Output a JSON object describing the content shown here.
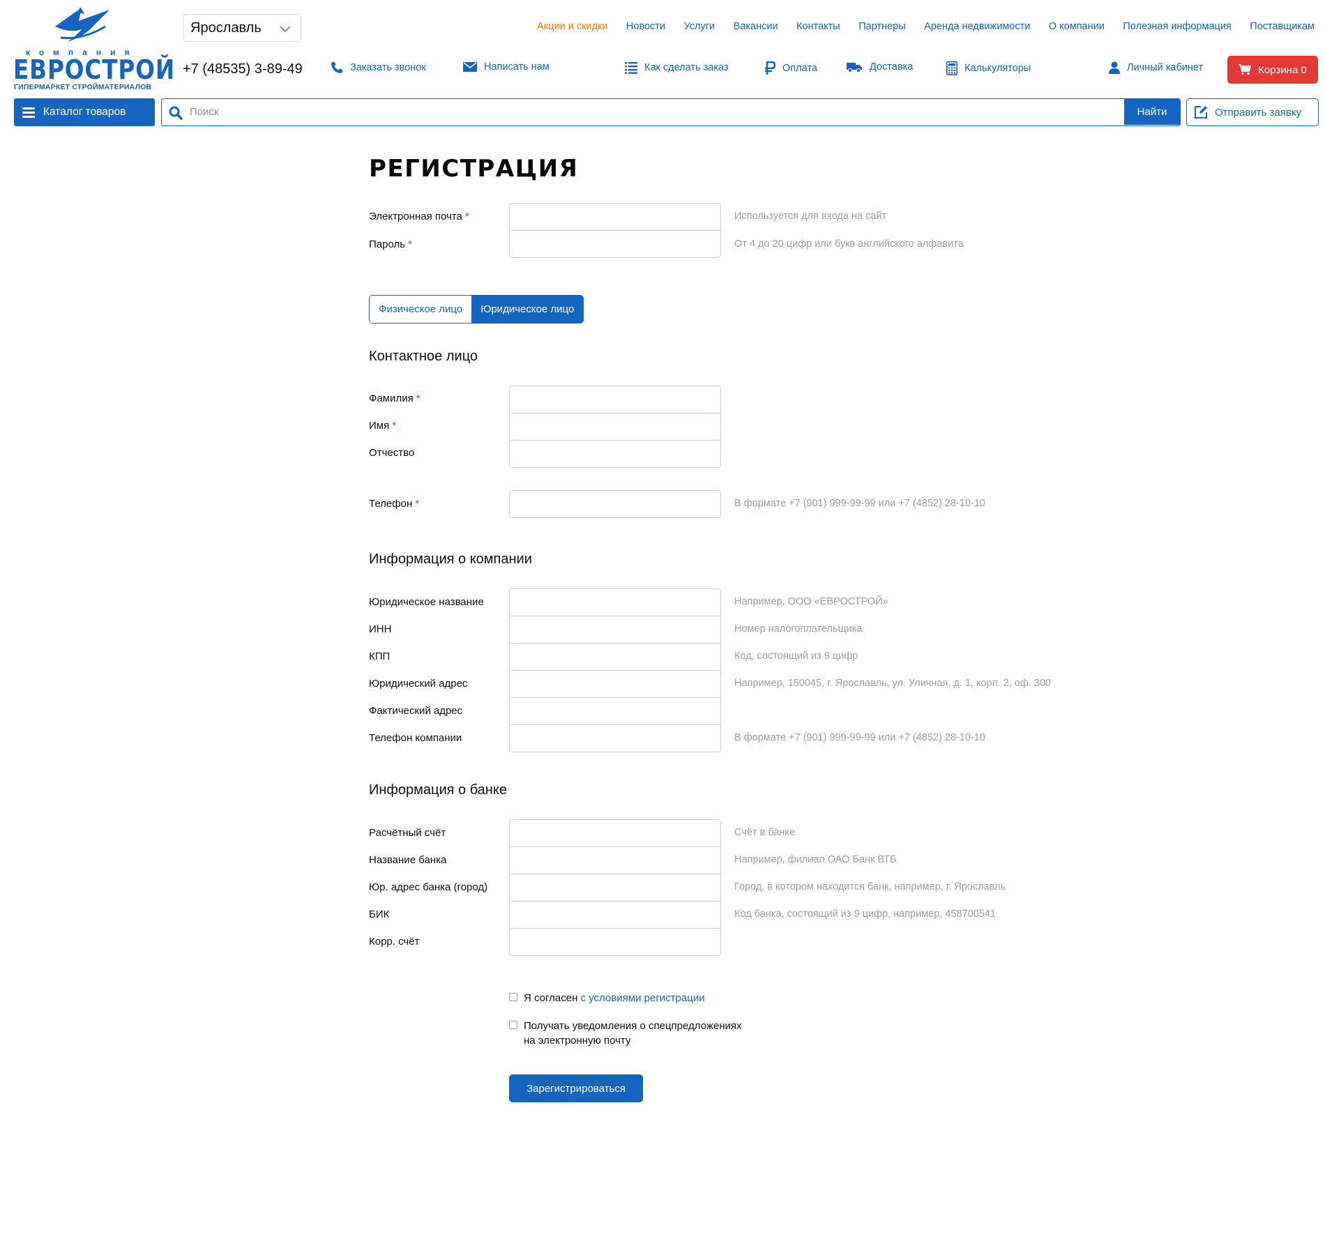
{
  "brand": {
    "company_word": "компания",
    "name": "ЕВРОСТРОЙ",
    "tagline": "ГИПЕРМАРКЕТ СТРОЙМАТЕРИАЛОВ",
    "primary_color": "#1565c0",
    "accent_color": "#e53935",
    "promo_color": "#f57c00"
  },
  "header": {
    "city": "Ярославль",
    "phone": "+7 (48535) 3-89-49",
    "call_link": "Заказать звонок",
    "write_link": "Написать нам",
    "top_nav": [
      "Акции и скидки",
      "Новости",
      "Услуги",
      "Вакансии",
      "Контакты",
      "Партнеры",
      "Аренда недвижимости",
      "О компании",
      "Полезная информация",
      "Поставщикам"
    ],
    "how_to_order": "Как сделать заказ",
    "payment": "Оплата",
    "delivery": "Доставка",
    "calculators": "Калькуляторы",
    "account": "Личный кабинет",
    "cart_label": "Корзина 0",
    "catalog_label": "Каталог товаров",
    "search_placeholder": "Поиск",
    "search_button": "Найти",
    "send_request": "Отправить заявку"
  },
  "form": {
    "title": "РЕГИСТРАЦИЯ",
    "required_mark": "*",
    "email_label": "Электронная почта",
    "email_hint": "Используется для входа на сайт",
    "password_label": "Пароль",
    "password_hint": "От 4 до 20 цифр или букв английского алфавита",
    "toggle_person": "Физическое лицо",
    "toggle_company": "Юридическое лицо",
    "active_toggle": "Юридическое лицо",
    "contact_section": "Контактное лицо",
    "lastname_label": "Фамилия",
    "firstname_label": "Имя",
    "middlename_label": "Отчество",
    "phone_label": "Телефон",
    "phone_hint": "В формате +7 (901) 999-99-99 или +7 (4852) 28-10-10",
    "company_section": "Информация о компании",
    "legal_name_label": "Юридическое название",
    "legal_name_hint": "Например, ООО «ЕВРОСТРОЙ»",
    "inn_label": "ИНН",
    "inn_hint": "Номер налогоплательщика",
    "kpp_label": "КПП",
    "kpp_hint": "Код, состоящий из 9 цифр",
    "legal_address_label": "Юридический адрес",
    "legal_address_hint": "Например, 150045, г. Ярославль, ул. Уличная, д. 1, корп. 2, оф. 300",
    "actual_address_label": "Фактический адрес",
    "company_phone_label": "Телефон компании",
    "company_phone_hint": "В формате +7 (901) 999-99-99 или +7 (4852) 28-10-10",
    "bank_section": "Информация о банке",
    "account_label": "Расчётный счёт",
    "account_hint": "Счёт в банке",
    "bank_name_label": "Название банка",
    "bank_name_hint": "Например, филиал ОАО Банк ВТБ",
    "bank_address_label": "Юр. адрес банка (город)",
    "bank_address_hint": "Город, в котором находится банк, например, г. Ярославль",
    "bik_label": "БИК",
    "bik_hint": "Код банка, состоящий из 9 цифр, например, 458700541",
    "corr_label": "Корр. счёт",
    "agree_text": "Я согласен",
    "agree_link": "с условиями регистрации",
    "notify_line1": "Получать уведомления о спецпредложениях",
    "notify_line2": "на электронную почту",
    "submit": "Зарегистрироваться"
  }
}
